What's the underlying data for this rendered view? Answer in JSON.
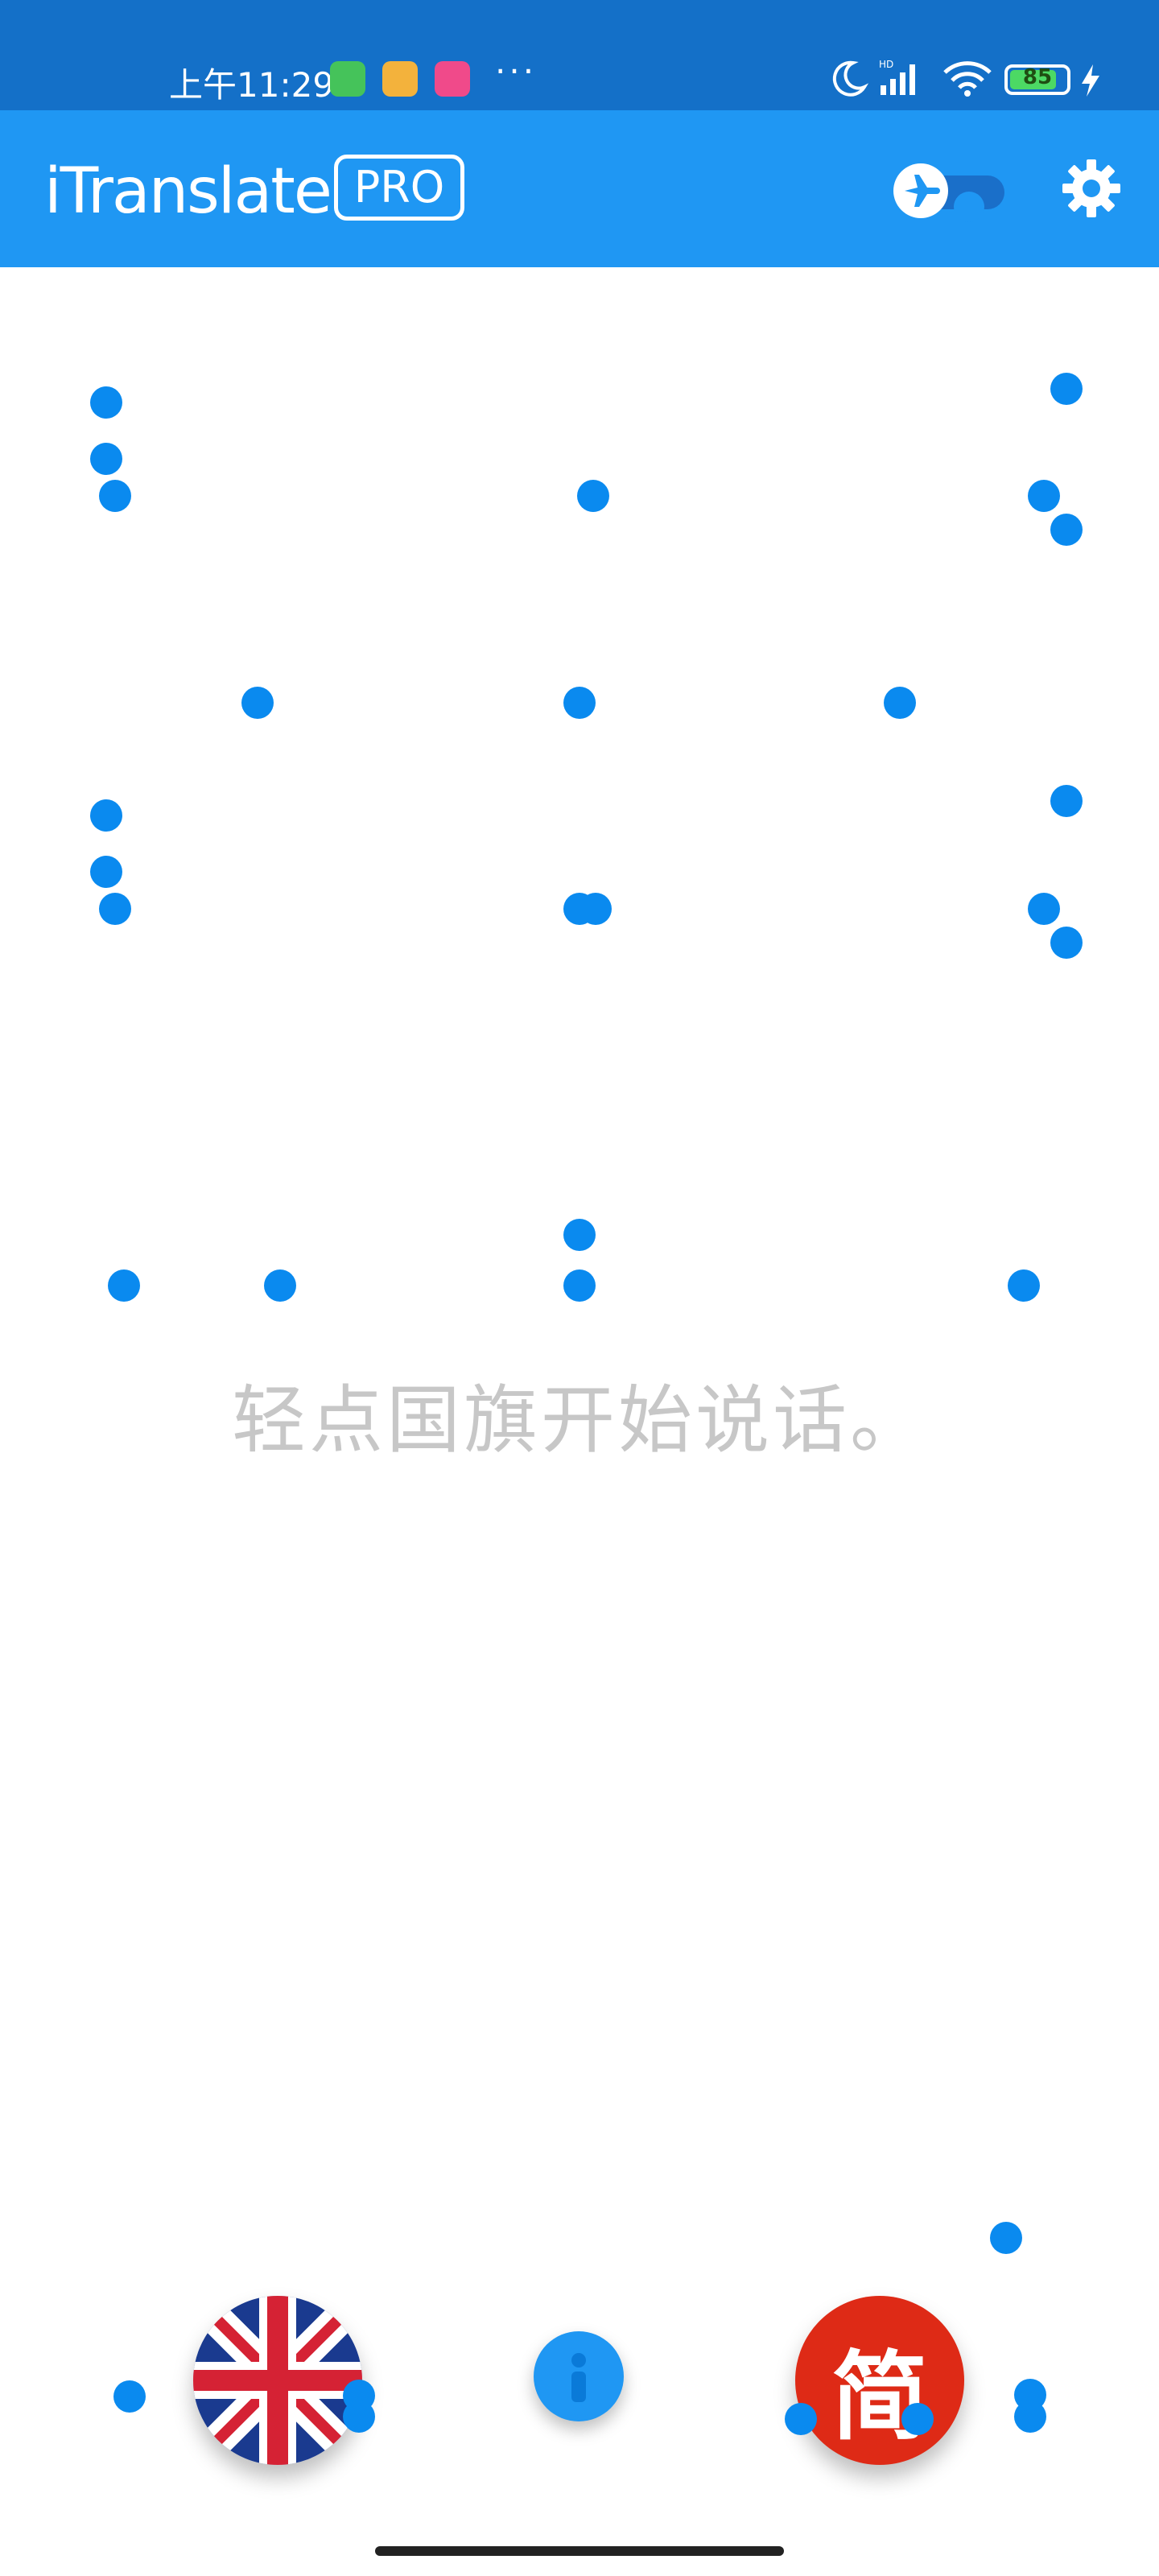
{
  "status_bar": {
    "time": "上午11:29",
    "more": "···",
    "battery_level": 85,
    "battery_text": "85",
    "icons": [
      "app-icon-green",
      "app-icon-orange",
      "app-icon-pink",
      "moon-icon",
      "signal-icon",
      "wifi-icon",
      "battery-icon",
      "charging-icon"
    ]
  },
  "app_bar": {
    "title": "iTranslate",
    "badge": "PRO",
    "offline_toggle_icon": "airplane-icon",
    "settings_icon": "gear-icon"
  },
  "main": {
    "placeholder": "轻点国旗开始说话。"
  },
  "bottom_bar": {
    "source_language_flag": "uk-flag-icon",
    "target_language_label": "简",
    "info_icon": "info-icon"
  },
  "colors": {
    "status_bar": "#1470c8",
    "app_bar": "#1f97f3",
    "accent_dot": "#0a8aef",
    "placeholder_text": "#c7c7c7",
    "cn_flag": "#de2a16"
  }
}
